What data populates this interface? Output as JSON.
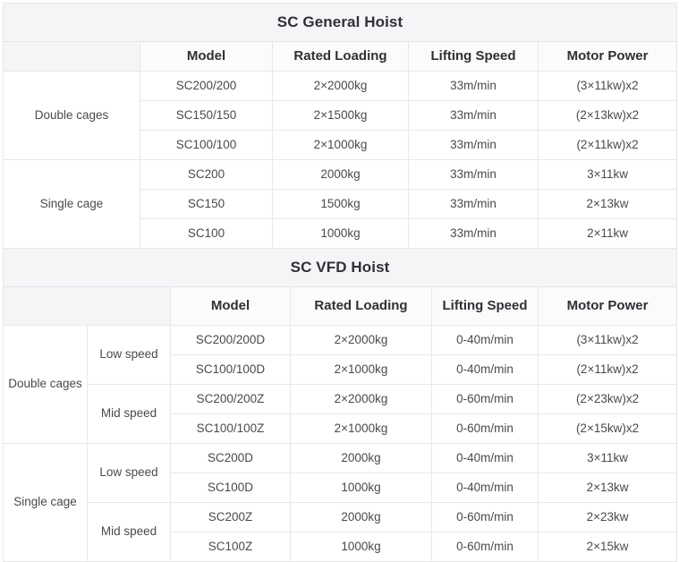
{
  "tables": [
    {
      "id": "sc-general-hoist",
      "title": "SC General Hoist",
      "blank_header": "",
      "headers": [
        "Model",
        "Rated Loading",
        "Lifting Speed",
        "Motor Power"
      ],
      "groups": [
        {
          "label": "Double cages",
          "rows": [
            {
              "model": "SC200/200",
              "rated_loading": "2×2000kg",
              "lifting_speed": "33m/min",
              "motor_power": "(3×11kw)x2"
            },
            {
              "model": "SC150/150",
              "rated_loading": "2×1500kg",
              "lifting_speed": "33m/min",
              "motor_power": "(2×13kw)x2"
            },
            {
              "model": "SC100/100",
              "rated_loading": "2×1000kg",
              "lifting_speed": "33m/min",
              "motor_power": "(2×11kw)x2"
            }
          ]
        },
        {
          "label": "Single cage",
          "rows": [
            {
              "model": "SC200",
              "rated_loading": "2000kg",
              "lifting_speed": "33m/min",
              "motor_power": "3×11kw"
            },
            {
              "model": "SC150",
              "rated_loading": "1500kg",
              "lifting_speed": "33m/min",
              "motor_power": "2×13kw"
            },
            {
              "model": "SC100",
              "rated_loading": "1000kg",
              "lifting_speed": "33m/min",
              "motor_power": "2×11kw"
            }
          ]
        }
      ]
    },
    {
      "id": "sc-vfd-hoist",
      "title": "SC VFD Hoist",
      "blank_header": "",
      "headers": [
        "Model",
        "Rated Loading",
        "Lifting Speed",
        "Motor Power"
      ],
      "groups": [
        {
          "label": "Double cages",
          "subgroups": [
            {
              "label": "Low speed",
              "rows": [
                {
                  "model": "SC200/200D",
                  "rated_loading": "2×2000kg",
                  "lifting_speed": "0-40m/min",
                  "motor_power": "(3×11kw)x2"
                },
                {
                  "model": "SC100/100D",
                  "rated_loading": "2×1000kg",
                  "lifting_speed": "0-40m/min",
                  "motor_power": "(2×11kw)x2"
                }
              ]
            },
            {
              "label": "Mid speed",
              "rows": [
                {
                  "model": "SC200/200Z",
                  "rated_loading": "2×2000kg",
                  "lifting_speed": "0-60m/min",
                  "motor_power": "(2×23kw)x2"
                },
                {
                  "model": "SC100/100Z",
                  "rated_loading": "2×1000kg",
                  "lifting_speed": "0-60m/min",
                  "motor_power": "(2×15kw)x2"
                }
              ]
            }
          ]
        },
        {
          "label": "Single cage",
          "subgroups": [
            {
              "label": "Low speed",
              "rows": [
                {
                  "model": "SC200D",
                  "rated_loading": "2000kg",
                  "lifting_speed": "0-40m/min",
                  "motor_power": "3×11kw"
                },
                {
                  "model": "SC100D",
                  "rated_loading": "1000kg",
                  "lifting_speed": "0-40m/min",
                  "motor_power": "2×13kw"
                }
              ]
            },
            {
              "label": "Mid speed",
              "rows": [
                {
                  "model": "SC200Z",
                  "rated_loading": "2000kg",
                  "lifting_speed": "0-60m/min",
                  "motor_power": "2×23kw"
                },
                {
                  "model": "SC100Z",
                  "rated_loading": "1000kg",
                  "lifting_speed": "0-60m/min",
                  "motor_power": "2×15kw"
                }
              ]
            }
          ]
        }
      ]
    }
  ],
  "colors": {
    "title_bg": "#f4f5f7",
    "group_bg": "#f2f3f6",
    "cell_bg": "#ffffff",
    "border": "#e6e8ea",
    "title_text": "#2f3135",
    "cell_text": "#4d4d4d"
  }
}
